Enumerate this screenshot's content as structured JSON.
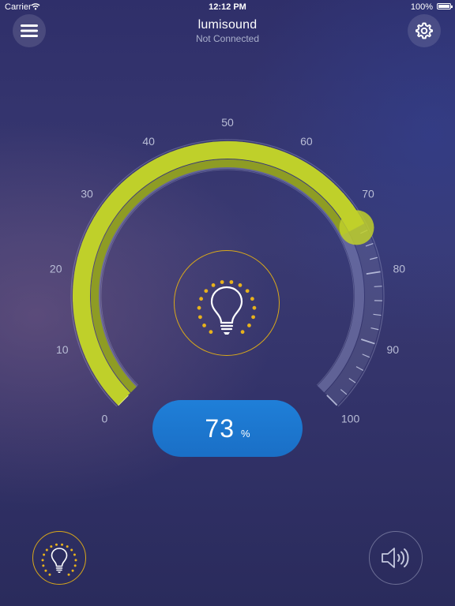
{
  "status_bar": {
    "carrier": "Carrier",
    "time": "12:12 PM",
    "battery": "100%"
  },
  "header": {
    "title": "lumisound",
    "subtitle": "Not Connected",
    "menu_icon": "hamburger-menu-icon",
    "settings_icon": "gear-icon"
  },
  "dial": {
    "tick_labels": [
      "0",
      "10",
      "20",
      "30",
      "40",
      "50",
      "60",
      "70",
      "80",
      "90",
      "100"
    ],
    "value": 73,
    "max": 100,
    "active_color": "#bfd02a",
    "center_icon": "lightbulb-icon"
  },
  "display": {
    "value": "73",
    "unit": "%"
  },
  "bottom_bar": {
    "light_mode_icon": "lightbulb-icon",
    "sound_mode_icon": "speaker-icon"
  },
  "colors": {
    "accent_yellow": "#d9a81a",
    "pill_blue": "#1f7fd8",
    "arc_green": "#bfd02a"
  }
}
